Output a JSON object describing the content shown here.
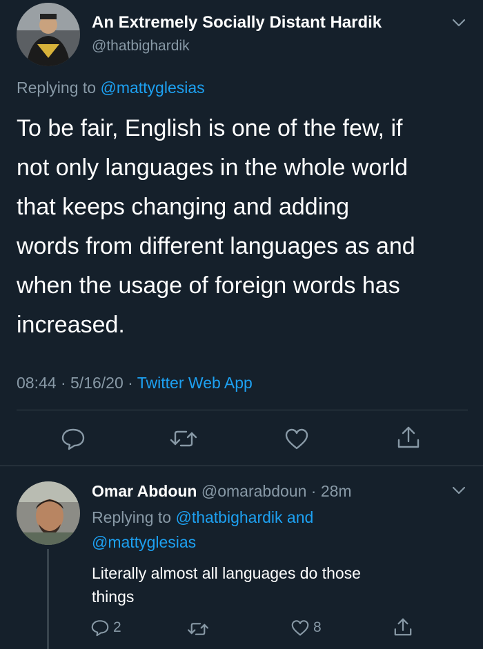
{
  "main_tweet": {
    "display_name": "An Extremely Socially Distant Hardik",
    "handle": "@thatbighardik",
    "replying_prefix": "Replying to",
    "replying_to": "@mattyglesias",
    "text_lines": [
      "To be fair, English is one of the few, if",
      "not only languages in the whole world",
      "that keeps changing and adding",
      "words from different languages as and",
      "when the usage of foreign words has",
      "increased."
    ],
    "meta_time_date": "08:44 · 5/16/20 ·",
    "meta_source": "Twitter Web App",
    "icons": [
      "reply-icon",
      "retweet-icon",
      "like-icon",
      "share-icon"
    ]
  },
  "reply_tweet": {
    "display_name": "Omar Abdoun",
    "handle_time": "@omarabdoun · 28m",
    "replying_prefix": "Replying to",
    "replying_to_line1": "@thatbighardik and",
    "replying_to_line2": "@mattyglesias",
    "text_lines": [
      "Literally almost all languages do those",
      "things"
    ],
    "reply_count": "2",
    "like_count": "8",
    "icons": [
      "reply-icon",
      "retweet-icon",
      "like-icon",
      "share-icon"
    ]
  },
  "colors": {
    "background": "#15202b",
    "text": "#ffffff",
    "muted": "#8899a6",
    "link": "#1da1f2",
    "divider": "#38444d"
  }
}
